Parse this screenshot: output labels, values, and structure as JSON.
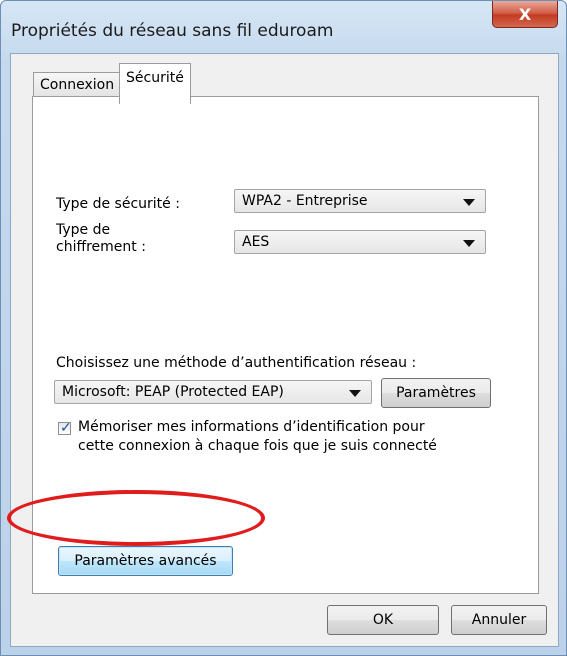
{
  "window": {
    "title": "Propriétés du réseau sans fil eduroam",
    "close_label": "X"
  },
  "tabs": [
    {
      "label": "Connexion",
      "selected": false
    },
    {
      "label": "Sécurité",
      "selected": true
    }
  ],
  "security": {
    "type_label": "Type de sécurité :",
    "type_value": "WPA2 - Entreprise",
    "encryption_label_line1": "Type de",
    "encryption_label_line2": "chiffrement :",
    "encryption_value": "AES",
    "auth_method_label": "Choisissez une méthode d’authentification réseau :",
    "auth_method_value": "Microsoft: PEAP (Protected EAP)",
    "settings_button": "Paramètres",
    "remember_checked": true,
    "remember_line1": "Mémoriser mes informations d’identification pour",
    "remember_line2": "cette connexion à chaque fois que je suis connecté",
    "advanced_button": "Paramètres avancés"
  },
  "footer": {
    "ok_label": "OK",
    "cancel_label": "Annuler"
  },
  "annotation": {
    "color": "#e01c1c",
    "target": "advanced-settings-button"
  },
  "icons": [
    "close-icon",
    "dropdown-arrow-icon",
    "checkmark-icon"
  ]
}
